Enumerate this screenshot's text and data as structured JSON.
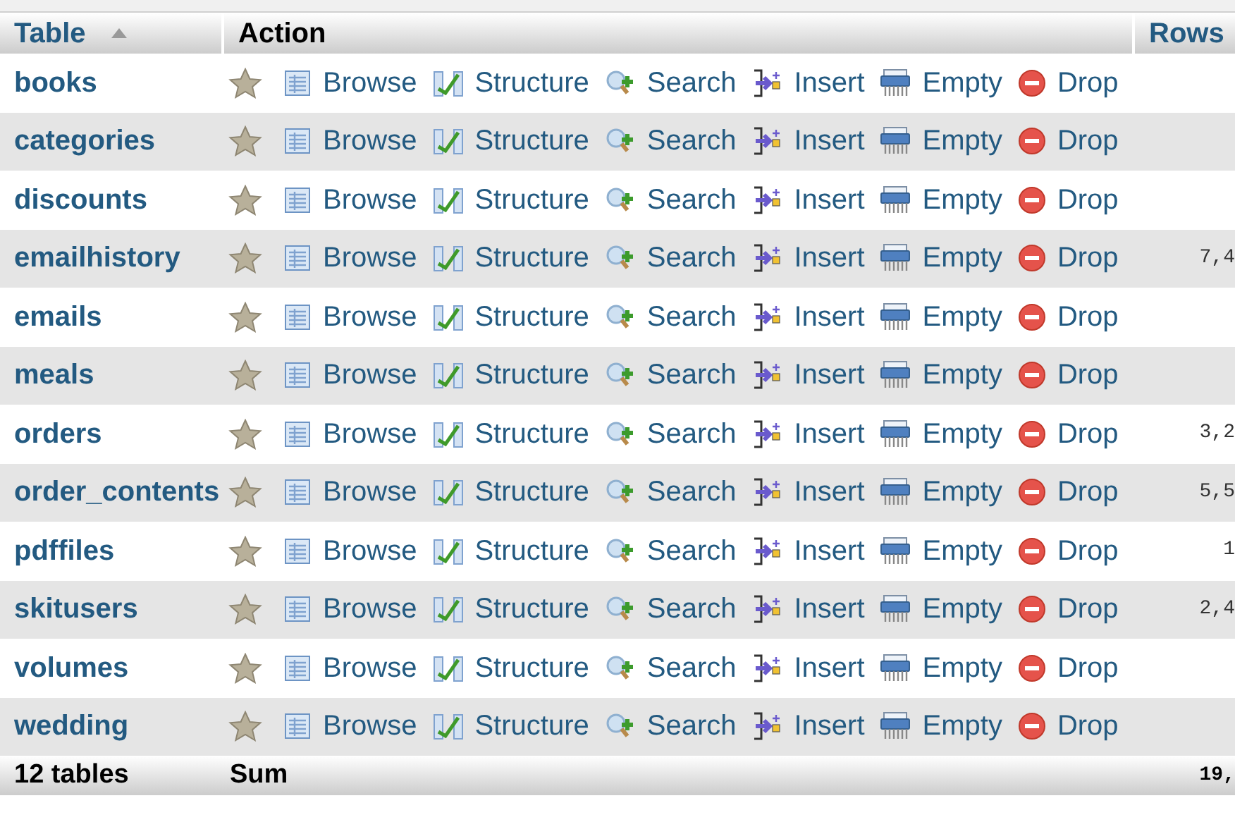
{
  "table": {
    "columns": [
      {
        "label": "Table",
        "sorted": true
      },
      {
        "label": "Action",
        "sorted": false
      },
      {
        "label": "Rows",
        "sorted": false
      }
    ],
    "rows": [
      {
        "name": "books",
        "actions": [
          "Browse",
          "Structure",
          "Search",
          "Insert",
          "Empty",
          "Drop"
        ]
      },
      {
        "name": "categories",
        "actions": [
          "Browse",
          "Structure",
          "Search",
          "Insert",
          "Empty",
          "Drop"
        ]
      },
      {
        "name": "discounts",
        "actions": [
          "Browse",
          "Structure",
          "Search",
          "Insert",
          "Empty",
          "Drop"
        ]
      },
      {
        "name": "emailhistory",
        "actions": [
          "Browse",
          "Structure",
          "Search",
          "Insert",
          "Empty",
          "Drop"
        ],
        "rows": "7,4"
      },
      {
        "name": "emails",
        "actions": [
          "Browse",
          "Structure",
          "Search",
          "Insert",
          "Empty",
          "Drop"
        ]
      },
      {
        "name": "meals",
        "actions": [
          "Browse",
          "Structure",
          "Search",
          "Insert",
          "Empty",
          "Drop"
        ]
      },
      {
        "name": "orders",
        "actions": [
          "Browse",
          "Structure",
          "Search",
          "Insert",
          "Empty",
          "Drop"
        ],
        "rows": "3,2"
      },
      {
        "name": "order_contents",
        "actions": [
          "Browse",
          "Structure",
          "Search",
          "Insert",
          "Empty",
          "Drop"
        ],
        "rows": "5,5"
      },
      {
        "name": "pdffiles",
        "actions": [
          "Browse",
          "Structure",
          "Search",
          "Insert",
          "Empty",
          "Drop"
        ],
        "rows": "1"
      },
      {
        "name": "skitusers",
        "actions": [
          "Browse",
          "Structure",
          "Search",
          "Insert",
          "Empty",
          "Drop"
        ],
        "rows": "2,4"
      },
      {
        "name": "volumes",
        "actions": [
          "Browse",
          "Structure",
          "Search",
          "Insert",
          "Empty",
          "Drop"
        ]
      },
      {
        "name": "wedding",
        "actions": [
          "Browse",
          "Structure",
          "Search",
          "Insert",
          "Empty",
          "Drop"
        ]
      }
    ],
    "footer": {
      "count": "12 tables",
      "label": "Sum",
      "rows": "19,"
    }
  }
}
